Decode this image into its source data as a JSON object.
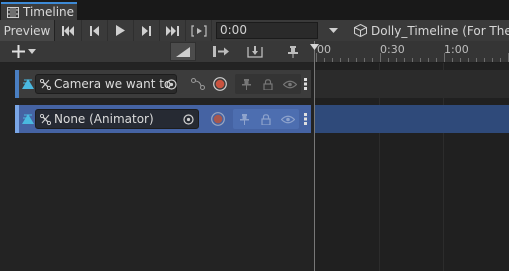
{
  "window": {
    "tab_title": "Timeline"
  },
  "toolbar": {
    "preview_label": "Preview",
    "time_value": "0:00",
    "asset_title": "Dolly_Timeline (For The T"
  },
  "ruler": {
    "labels": [
      "00",
      "0:30",
      "1:00"
    ]
  },
  "tracks": [
    {
      "binding_label": "Camera we want to"
    },
    {
      "binding_label": "None (Animator)"
    }
  ],
  "colors": {
    "accent": "#3d8ad6",
    "selected_track": "#4563a3",
    "record_button": "#c9533f"
  }
}
